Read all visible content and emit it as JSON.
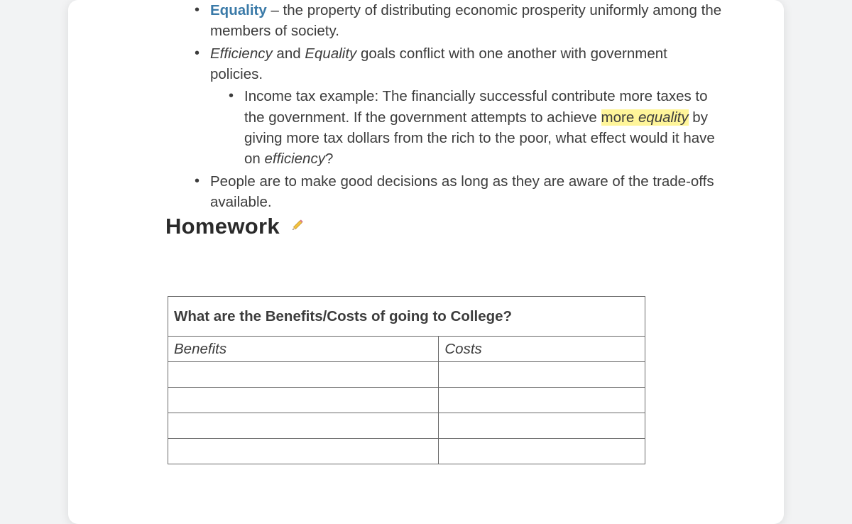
{
  "bullets": {
    "equality_term": "Equality",
    "equality_def": " – the property of distributing economic prosperity uniformly among the members of society.",
    "conflict_a": "Efficiency",
    "conflict_mid": " and ",
    "conflict_b": "Equality",
    "conflict_rest": " goals conflict with one another with government policies.",
    "subitem_pre": "Income tax example: The financially successful contribute more taxes to the government.  If the government attempts to achieve ",
    "subitem_hl_a": "more ",
    "subitem_hl_b": "equality",
    "subitem_mid": " by giving more tax dollars from the rich to the poor, what effect would it have on ",
    "subitem_eff": "efficiency",
    "subitem_q": "?",
    "people_line": "People are to make good decisions as long as they are aware of the trade-offs available."
  },
  "heading": "Homework ",
  "table": {
    "title": "What are the Benefits/Costs of going to College?",
    "col1": "Benefits",
    "col2": "Costs"
  }
}
